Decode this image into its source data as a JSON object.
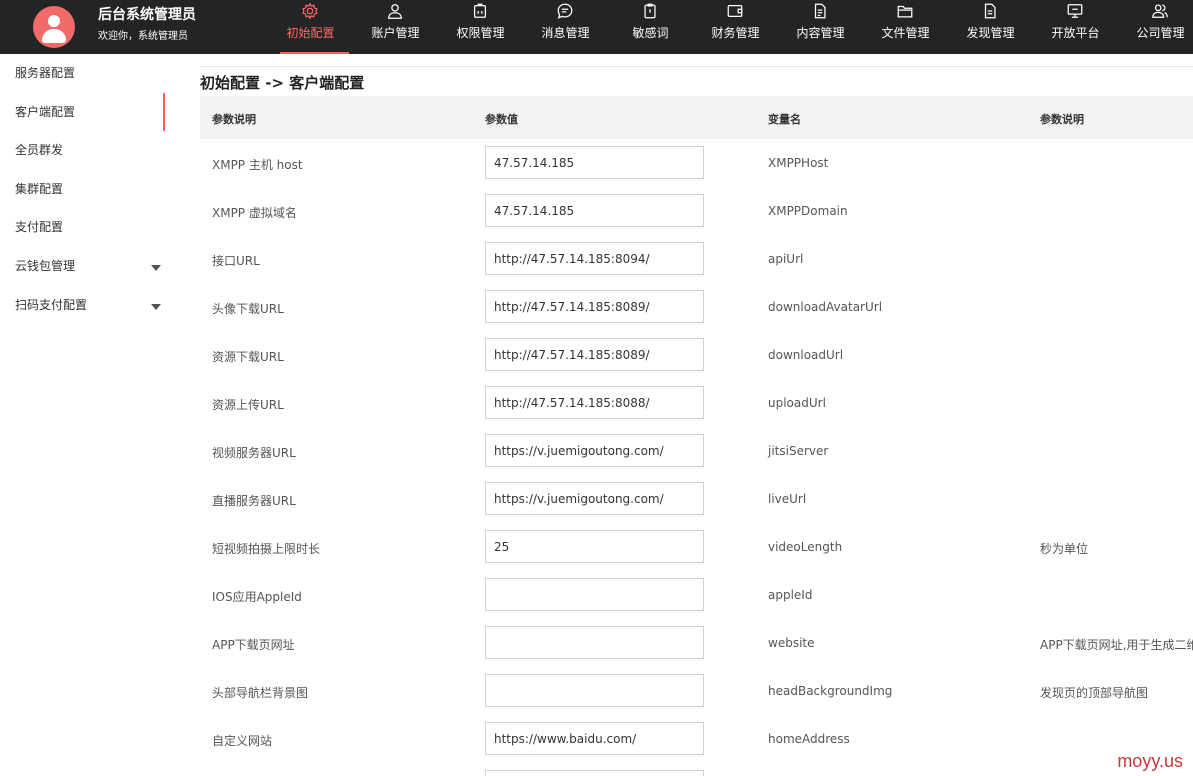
{
  "header": {
    "title": "后台系统管理员",
    "subtitle": "欢迎你，系统管理员",
    "accent_color": "#ff5a5a",
    "nav": [
      {
        "label": "初始配置",
        "icon": "gear-icon"
      },
      {
        "label": "账户管理",
        "icon": "user-icon"
      },
      {
        "label": "权限管理",
        "icon": "lock-icon"
      },
      {
        "label": "消息管理",
        "icon": "message-icon"
      },
      {
        "label": "敏感词",
        "icon": "clipboard-icon"
      },
      {
        "label": "财务管理",
        "icon": "wallet-icon"
      },
      {
        "label": "内容管理",
        "icon": "document-icon"
      },
      {
        "label": "文件管理",
        "icon": "folder-icon"
      },
      {
        "label": "发现管理",
        "icon": "file-list-icon"
      },
      {
        "label": "开放平台",
        "icon": "monitor-icon"
      },
      {
        "label": "公司管理",
        "icon": "users-icon"
      }
    ]
  },
  "sidebar": {
    "items": [
      {
        "label": "服务器配置"
      },
      {
        "label": "客户端配置"
      },
      {
        "label": "全员群发"
      },
      {
        "label": "集群配置"
      },
      {
        "label": "支付配置"
      },
      {
        "label": "云钱包管理"
      },
      {
        "label": "扫码支付配置"
      }
    ]
  },
  "main": {
    "title": "初始配置 -> 客户端配置",
    "columns": [
      "参数说明",
      "参数值",
      "变量名",
      "参数说明"
    ],
    "rows": [
      {
        "desc": "XMPP 主机 host",
        "value": "47.57.14.185",
        "var": "XMPPHost",
        "note": ""
      },
      {
        "desc": "XMPP 虚拟域名",
        "value": "47.57.14.185",
        "var": "XMPPDomain",
        "note": ""
      },
      {
        "desc": "接口URL",
        "value": "http://47.57.14.185:8094/",
        "var": "apiUrl",
        "note": ""
      },
      {
        "desc": "头像下载URL",
        "value": "http://47.57.14.185:8089/",
        "var": "downloadAvatarUrl",
        "note": ""
      },
      {
        "desc": "资源下载URL",
        "value": "http://47.57.14.185:8089/",
        "var": "downloadUrl",
        "note": ""
      },
      {
        "desc": "资源上传URL",
        "value": "http://47.57.14.185:8088/",
        "var": "uploadUrl",
        "note": ""
      },
      {
        "desc": "视频服务器URL",
        "value": "https://v.juemigoutong.com/",
        "var": "jitsiServer",
        "note": ""
      },
      {
        "desc": "直播服务器URL",
        "value": "https://v.juemigoutong.com/",
        "var": "liveUrl",
        "note": ""
      },
      {
        "desc": "短视频拍摄上限时长",
        "value": "25",
        "var": "videoLength",
        "note": "秒为单位"
      },
      {
        "desc": "IOS应用AppleId",
        "value": "",
        "var": "appleId",
        "note": ""
      },
      {
        "desc": "APP下载页网址",
        "value": "",
        "var": "website",
        "note": "APP下载页网址,用于生成二维"
      },
      {
        "desc": "头部导航栏背景图",
        "value": "",
        "var": "headBackgroundImg",
        "note": "发现页的顶部导航图"
      },
      {
        "desc": "自定义网站",
        "value": "https://www.baidu.com/",
        "var": "homeAddress",
        "note": ""
      },
      {
        "desc": "",
        "value": "",
        "var": "",
        "note": ""
      }
    ]
  },
  "watermark": "moyy.us"
}
